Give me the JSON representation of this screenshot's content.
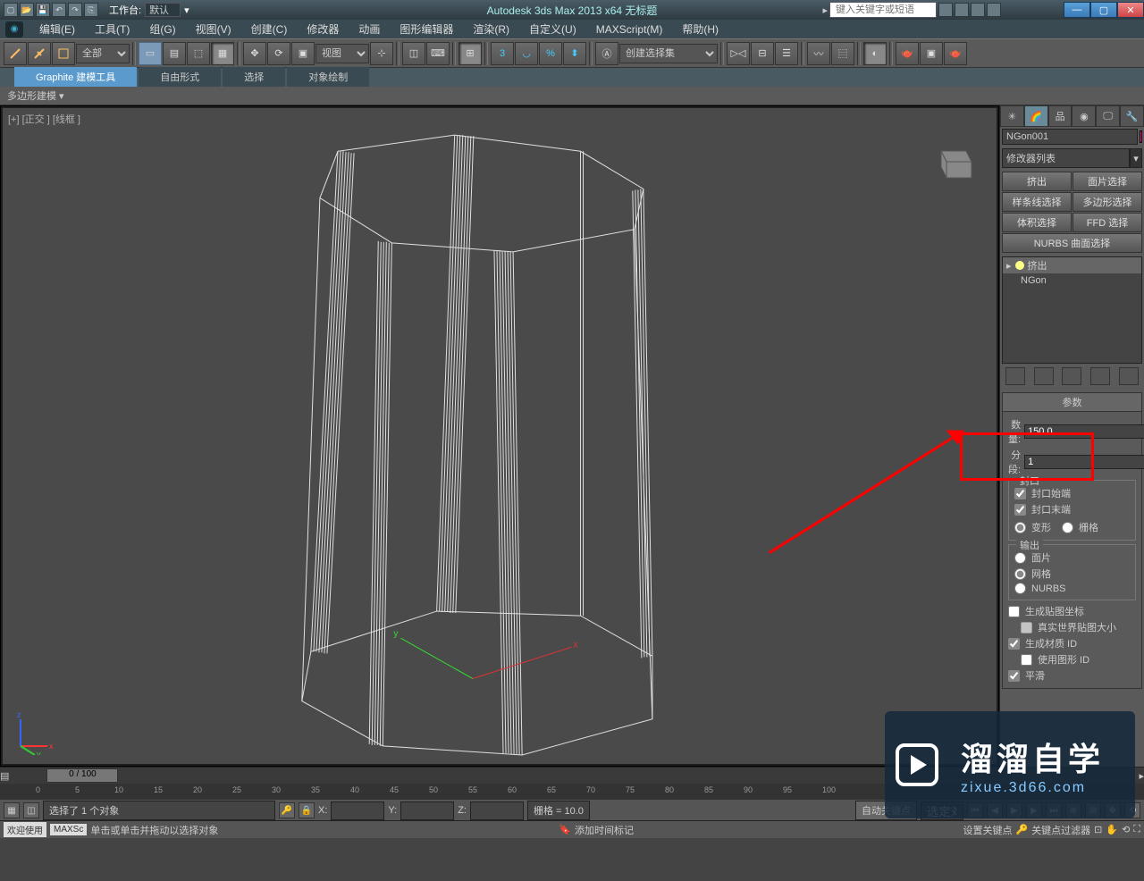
{
  "title_bar": {
    "workspace_label": "工作台: ",
    "workspace_value": "默认",
    "app_title": "Autodesk 3ds Max  2013  x64      无标题",
    "search_placeholder": "键入关键字或短语"
  },
  "menus": [
    "编辑(E)",
    "工具(T)",
    "组(G)",
    "视图(V)",
    "创建(C)",
    "修改器",
    "动画",
    "图形编辑器",
    "渲染(R)",
    "自定义(U)",
    "MAXScript(M)",
    "帮助(H)"
  ],
  "toolbar": {
    "filter": "全部",
    "view_combo": "视图",
    "set_combo": "创建选择集"
  },
  "ribbon": {
    "tabs": [
      "Graphite 建模工具",
      "自由形式",
      "选择",
      "对象绘制"
    ],
    "sub": "多边形建模"
  },
  "viewport": {
    "label": "[+] [正交 ] [线框 ]"
  },
  "cmd_panel": {
    "object_name": "NGon001",
    "mod_list_label": "修改器列表",
    "buttons": [
      "挤出",
      "面片选择",
      "样条线选择",
      "多边形选择",
      "体积选择",
      "FFD 选择"
    ],
    "nurbs_btn": "NURBS 曲面选择",
    "stack": {
      "head": "挤出",
      "item": "NGon"
    },
    "rollout_title": "参数",
    "amount_label": "数量:",
    "amount_value": "150.0",
    "segments_label": "分段:",
    "segments_value": "1",
    "cap_group": "封口",
    "cap_start": "封口始端",
    "cap_end": "封口末端",
    "morph": "变形",
    "grid": "栅格",
    "output_group": "输出",
    "patch": "面片",
    "mesh": "网格",
    "nurbs": "NURBS",
    "gen_map": "生成贴图坐标",
    "real_world": "真实世界贴图大小",
    "gen_mat": "生成材质 ID",
    "use_shape": "使用图形 ID",
    "smooth": "平滑"
  },
  "timeline": {
    "slider": "0 / 100",
    "ticks": [
      0,
      5,
      10,
      15,
      20,
      25,
      30,
      35,
      40,
      45,
      50,
      55,
      60,
      65,
      70,
      75,
      80,
      85,
      90,
      95,
      100
    ]
  },
  "status": {
    "sel": "选择了 1 个对象",
    "x": "X:",
    "y": "Y:",
    "z": "Z:",
    "grid_label": "栅格 = 10.0",
    "autokey": "自动关键点",
    "selset": "选定对",
    "welcome": "欢迎使用",
    "maxs": "MAXSc",
    "prompt": "单击或单击并拖动以选择对象",
    "addtag": "添加时间标记",
    "setkey": "设置关键点",
    "keyfilter": "关键点过滤器"
  },
  "watermark": {
    "txt1": "溜溜自学",
    "txt2": "zixue.3d66.com"
  }
}
